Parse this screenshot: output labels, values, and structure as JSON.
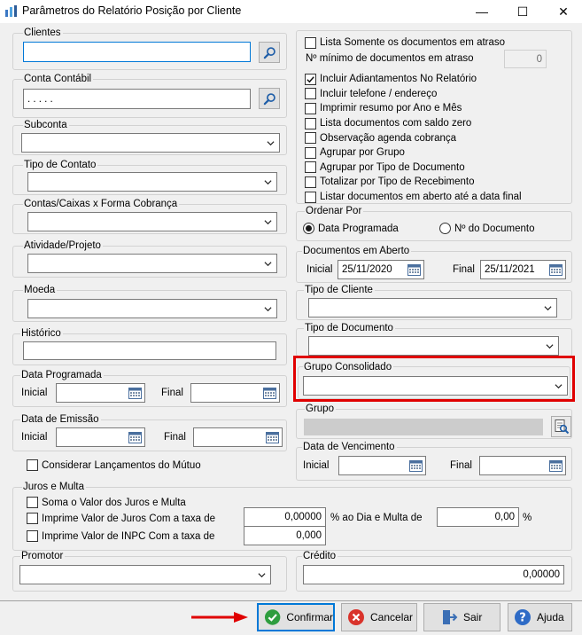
{
  "window": {
    "title": "Parâmetros do Relatório Posição por Cliente",
    "minimize_glyph": "—",
    "maximize_glyph": "☐",
    "close_glyph": "✕"
  },
  "left": {
    "clientes": {
      "label": "Clientes",
      "value": ""
    },
    "conta_contabil": {
      "label": "Conta Contábil",
      "value": ". . . . ."
    },
    "subconta": {
      "label": "Subconta",
      "value": ""
    },
    "tipo_contato": {
      "label": "Tipo de Contato",
      "value": ""
    },
    "contas_caixas": {
      "label": "Contas/Caixas x Forma Cobrança",
      "value": ""
    },
    "atividade_projeto": {
      "label": "Atividade/Projeto",
      "value": ""
    },
    "moeda": {
      "label": "Moeda",
      "value": ""
    },
    "historico": {
      "label": "Histórico",
      "value": ""
    },
    "data_programada": {
      "label": "Data Programada",
      "inicial_label": "Inicial",
      "final_label": "Final",
      "inicial": "",
      "final": ""
    },
    "data_emissao": {
      "label": "Data de Emissão",
      "inicial_label": "Inicial",
      "final_label": "Final",
      "inicial": "",
      "final": ""
    },
    "considerar_mutuo": {
      "label": "Considerar Lançamentos do Mútuo",
      "checked": false
    }
  },
  "juros": {
    "label": "Juros e Multa",
    "soma": {
      "label": "Soma o Valor dos Juros e Multa",
      "checked": false
    },
    "imprime_juros": {
      "label": "Imprime Valor de  Juros Com a taxa de",
      "checked": false,
      "value": "0,00000"
    },
    "dia_multa_label": "% ao Dia e Multa de",
    "multa_value": "0,00",
    "percent_label": "%",
    "imprime_inpc": {
      "label": "Imprime Valor de  INPC Com a taxa de",
      "checked": false,
      "value": "0,000"
    }
  },
  "promotor": {
    "label": "Promotor",
    "value": ""
  },
  "credito": {
    "label": "Crédito",
    "value": "0,00000"
  },
  "right": {
    "options": [
      {
        "label": "Lista Somente os documentos em atraso",
        "checked": false
      },
      {
        "label": "Incluir Adiantamentos No Relatório",
        "checked": true
      },
      {
        "label": "Incluir telefone / endereço",
        "checked": false
      },
      {
        "label": "Imprimir resumo por Ano e Mês",
        "checked": false
      },
      {
        "label": "Lista documentos com saldo zero",
        "checked": false
      },
      {
        "label": "Observação agenda cobrança",
        "checked": false
      },
      {
        "label": "Agrupar por Grupo",
        "checked": false
      },
      {
        "label": "Agrupar por Tipo de Documento",
        "checked": false
      },
      {
        "label": "Totalizar por Tipo de Recebimento",
        "checked": false
      },
      {
        "label": "Listar documentos em aberto até a data final",
        "checked": false
      }
    ],
    "min_docs_label": "Nº mínimo de documentos em atraso",
    "min_docs_value": "0",
    "ordenar": {
      "label": "Ordenar Por",
      "opt1": "Data Programada",
      "opt2": "Nº do Documento",
      "selected": "opt1"
    },
    "docs_aberto": {
      "label": "Documentos em Aberto",
      "inicial_label": "Inicial",
      "inicial": "25/11/2020",
      "final_label": "Final",
      "final": "25/11/2021"
    },
    "tipo_cliente": {
      "label": "Tipo de Cliente",
      "value": ""
    },
    "tipo_documento": {
      "label": "Tipo de Documento",
      "value": ""
    },
    "grupo_consolidado": {
      "label": "Grupo Consolidado",
      "value": ""
    },
    "grupo": {
      "label": "Grupo",
      "value": ""
    },
    "data_vencimento": {
      "label": "Data de Vencimento",
      "inicial_label": "Inicial",
      "final_label": "Final",
      "inicial": "",
      "final": ""
    }
  },
  "buttons": {
    "confirmar": "Confirmar",
    "cancelar": "Cancelar",
    "sair": "Sair",
    "ajuda": "Ajuda"
  },
  "colors": {
    "highlight": "#e00000",
    "accent": "#0078d7",
    "confirm_green": "#2e9d3e",
    "cancel_red": "#d9332b",
    "help_blue": "#2e6bc6"
  }
}
